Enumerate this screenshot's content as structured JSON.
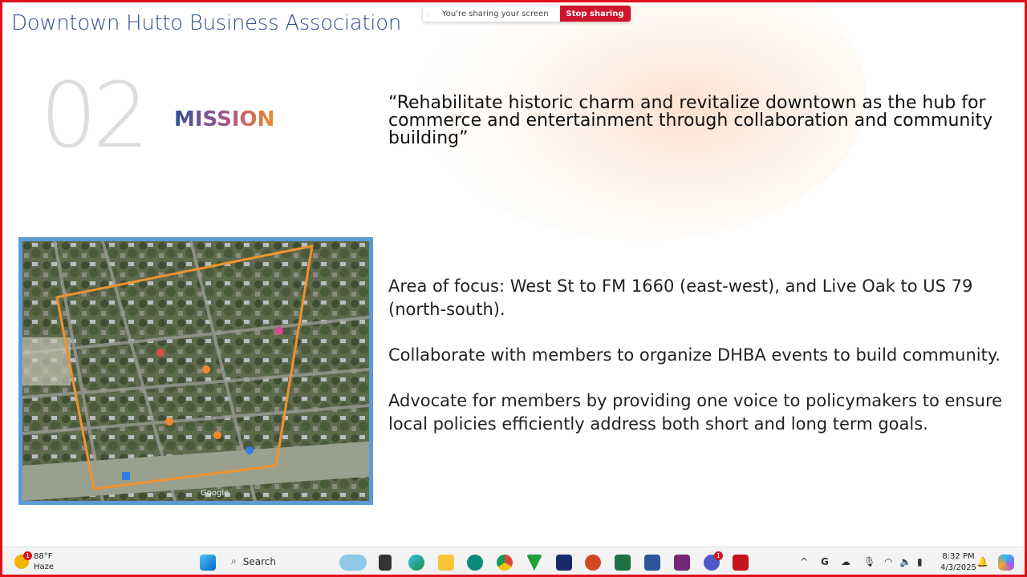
{
  "slide": {
    "title": "Downtown Hutto Business Association",
    "section_number": "02",
    "section_label": "MISSION",
    "quote": "“Rehabilitate historic charm and revitalize downtown as the hub for commerce and entertainment through collaboration and community building”",
    "paragraphs": [
      "Area of focus: West St to FM 1660 (east-west), and Live Oak to US 79 (north-south).",
      "Collaborate with members to organize DHBA events to build community.",
      "Advocate for members by providing one voice to policymakers to ensure local policies efficiently address both short and long term goals."
    ],
    "map": {
      "watermark": "Google",
      "border_color": "#5b9bd5",
      "boundary_color": "#f0922e"
    }
  },
  "sharing": {
    "message": "You're sharing your screen",
    "stop_label": "Stop sharing",
    "accent": "#d0142c"
  },
  "taskbar": {
    "weather": {
      "temp": "88°F",
      "condition": "Haze",
      "badge": "1"
    },
    "search_label": "Search",
    "apps": [
      "widgets",
      "terminal",
      "edge",
      "file-explorer",
      "sharepoint",
      "chrome",
      "vpn",
      "pcs",
      "powerpoint",
      "excel",
      "word",
      "power-automate",
      "teams",
      "acrobat"
    ],
    "teams_badge": "1",
    "clock": {
      "time": "8:32 PM",
      "date": "4/3/2025"
    }
  }
}
